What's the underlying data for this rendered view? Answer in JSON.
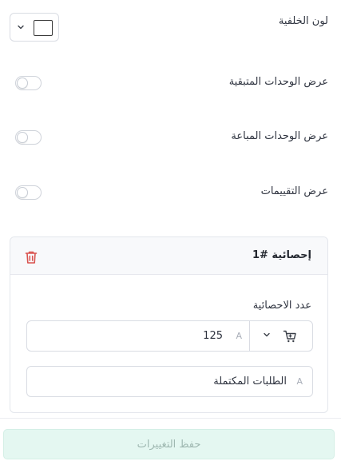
{
  "background": {
    "label": "لون الخلفية",
    "color": "#ffffff"
  },
  "toggles": [
    {
      "label": "عرض الوحدات المتبقية",
      "on": false
    },
    {
      "label": "عرض الوحدات المباعة",
      "on": false
    },
    {
      "label": "عرض التقييمات",
      "on": false
    }
  ],
  "stat_card": {
    "title": "إحصائية #1",
    "count_label": "عدد الاحصائية",
    "count_value": "125",
    "lang_glyph": "A",
    "icon": "cart-icon",
    "name_value": "الطلبات المكتملة"
  },
  "save_button": {
    "label": "حفظ التغييرات"
  },
  "colors": {
    "accent_light": "#e4f7f1",
    "danger": "#d9534f"
  }
}
